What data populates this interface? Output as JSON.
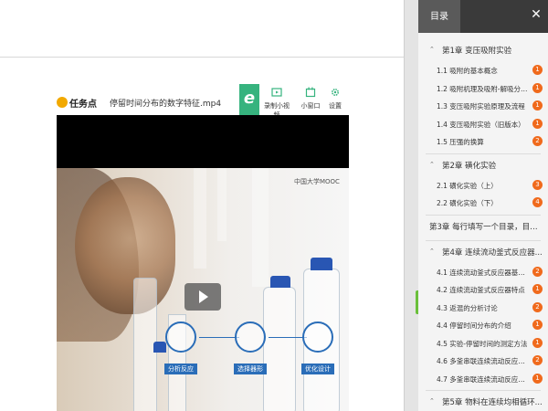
{
  "player": {
    "task_label": "任务点",
    "video_title": "停留时间分布的数字特征.mp4",
    "logo_letter": "e",
    "tools": {
      "record": "录制小视频",
      "small_window": "小窗口",
      "settings": "设置"
    },
    "watermark": "中国大学MOOC",
    "steps": [
      "分析反应",
      "选择器形",
      "优化设计"
    ]
  },
  "colors": {
    "accent_green": "#36b37e",
    "badge_orange": "#f06a1c",
    "step_blue": "#2a6db8"
  },
  "toc": {
    "tab_label": "目录",
    "chapters": [
      {
        "title": "第1章 变压吸附实验",
        "items": [
          {
            "label": "1.1 吸附的基本概念",
            "badge": "1"
          },
          {
            "label": "1.2 吸附机理及吸附-解吸分离过程",
            "badge": "1"
          },
          {
            "label": "1.3 变压吸附实验原理及流程",
            "badge": "1"
          },
          {
            "label": "1.4 变压吸附实验（旧版本）",
            "badge": "1"
          },
          {
            "label": "1.5 压强的换算",
            "badge": "2"
          }
        ]
      },
      {
        "title": "第2章 磺化实验",
        "items": [
          {
            "label": "2.1 磺化实验（上）",
            "badge": "3"
          },
          {
            "label": "2.2 磺化实验（下）",
            "badge": "4"
          }
        ]
      },
      {
        "title": "第3章 每行填写一个目录，目录...",
        "items": []
      },
      {
        "title": "第4章 连续流动釜式反应器...",
        "items": [
          {
            "label": "4.1 连续流动釜式反应器基本概念",
            "badge": "2"
          },
          {
            "label": "4.2 连续流动釜式反应器特点",
            "badge": "1"
          },
          {
            "label": "4.3 返混的分析讨论",
            "badge": "2"
          },
          {
            "label": "4.4 停留时间分布的介绍",
            "badge": "1"
          },
          {
            "label": "4.5 实验-停留时间的测定方法",
            "badge": "1"
          },
          {
            "label": "4.6 多釜串联连续流动反应器中的...",
            "badge": "2"
          },
          {
            "label": "4.7 多釜串联连续流动反应器中的...",
            "badge": "1"
          }
        ]
      },
      {
        "title": "第5章 物料在连续均相循环...",
        "items": []
      }
    ]
  }
}
